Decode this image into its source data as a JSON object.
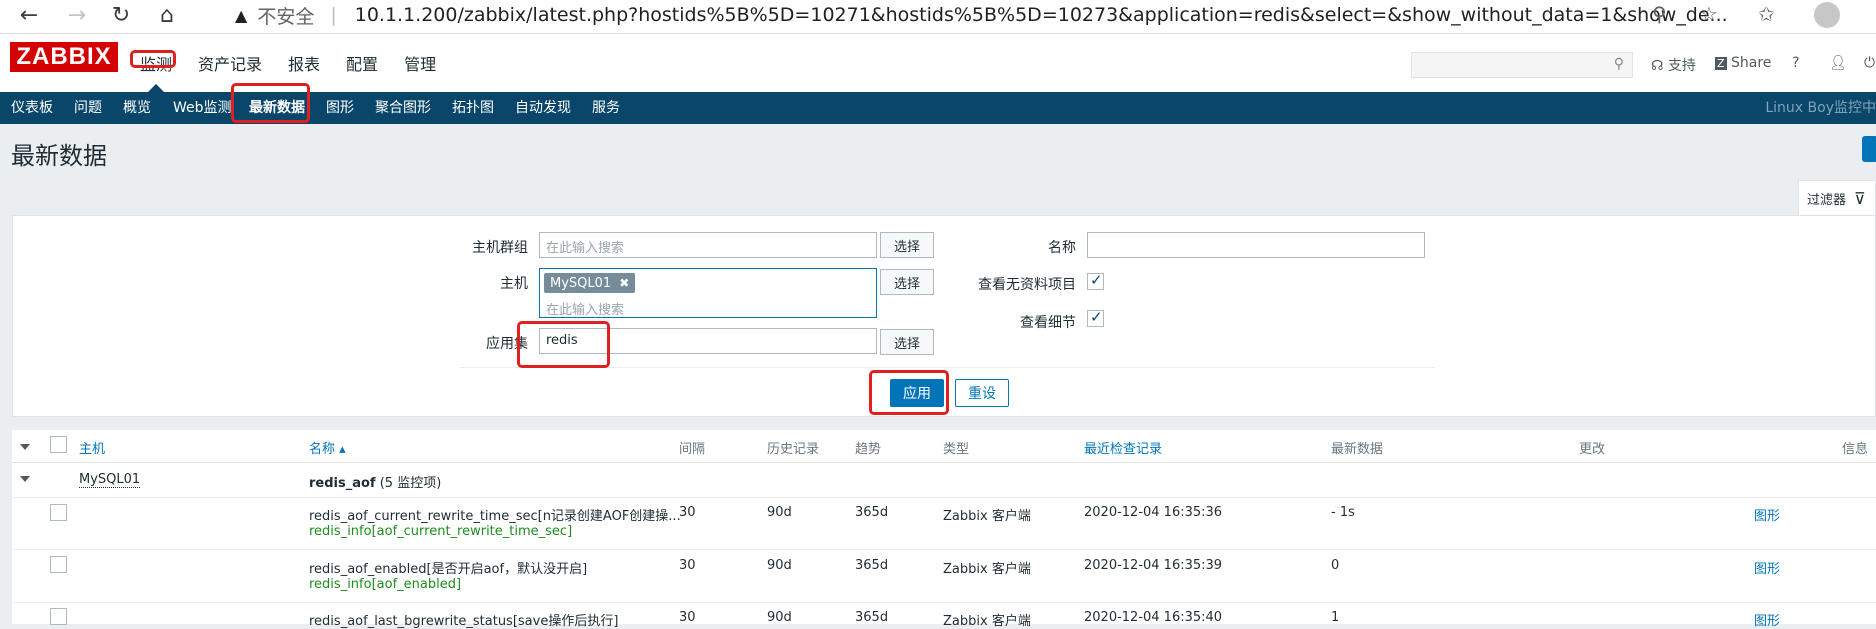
{
  "browser": {
    "warning": "不安全",
    "url": "10.1.1.200/zabbix/latest.php?hostids%5B%5D=10271&hostids%5B%5D=10273&application=redis&select=&show_without_data=1&show_de..."
  },
  "header": {
    "logo": "ZABBIX",
    "menu": [
      "监测",
      "资产记录",
      "报表",
      "配置",
      "管理"
    ],
    "support": "支持",
    "share": "Share",
    "help": "?"
  },
  "subnav": {
    "items": [
      "仪表板",
      "问题",
      "概览",
      "Web监测",
      "最新数据",
      "图形",
      "聚合图形",
      "拓扑图",
      "自动发现",
      "服务"
    ],
    "right_text": "Linux Boy监控中"
  },
  "page": {
    "title": "最新数据"
  },
  "filter": {
    "tab_label": "过滤器",
    "hostgroup_label": "主机群组",
    "hostgroup_placeholder": "在此输入搜索",
    "host_label": "主机",
    "host_tag": "MySQL01",
    "host_placeholder": "在此输入搜索",
    "application_label": "应用集",
    "application_value": "redis",
    "select_label": "选择",
    "name_label": "名称",
    "show_without_data_label": "查看无资料项目",
    "show_details_label": "查看细节",
    "apply_label": "应用",
    "reset_label": "重设"
  },
  "table": {
    "headers": {
      "host": "主机",
      "name": "名称 ▴",
      "interval": "间隔",
      "history": "历史记录",
      "trends": "趋势",
      "type": "类型",
      "lastcheck": "最近检查记录",
      "lastvalue": "最新数据",
      "change": "更改",
      "info": "信息"
    },
    "group": {
      "host": "MySQL01",
      "app": "redis_aof",
      "count": "(5 监控项)"
    },
    "rows": [
      {
        "name": "redis_aof_current_rewrite_time_sec[n记录创建AOF创建操...",
        "key": "redis_info[aof_current_rewrite_time_sec]",
        "interval": "30",
        "history": "90d",
        "trends": "365d",
        "type": "Zabbix 客户端",
        "lastcheck": "2020-12-04 16:35:36",
        "lastvalue": "- 1s",
        "graph": "图形"
      },
      {
        "name": "redis_aof_enabled[是否开启aof，默认没开启]",
        "key": "redis_info[aof_enabled]",
        "interval": "30",
        "history": "90d",
        "trends": "365d",
        "type": "Zabbix 客户端",
        "lastcheck": "2020-12-04 16:35:39",
        "lastvalue": "0",
        "graph": "图形"
      },
      {
        "name": "redis_aof_last_bgrewrite_status[save操作后执行]",
        "key": "",
        "interval": "30",
        "history": "90d",
        "trends": "365d",
        "type": "Zabbix 客户端",
        "lastcheck": "2020-12-04 16:35:40",
        "lastvalue": "1",
        "graph": "图形"
      }
    ]
  }
}
